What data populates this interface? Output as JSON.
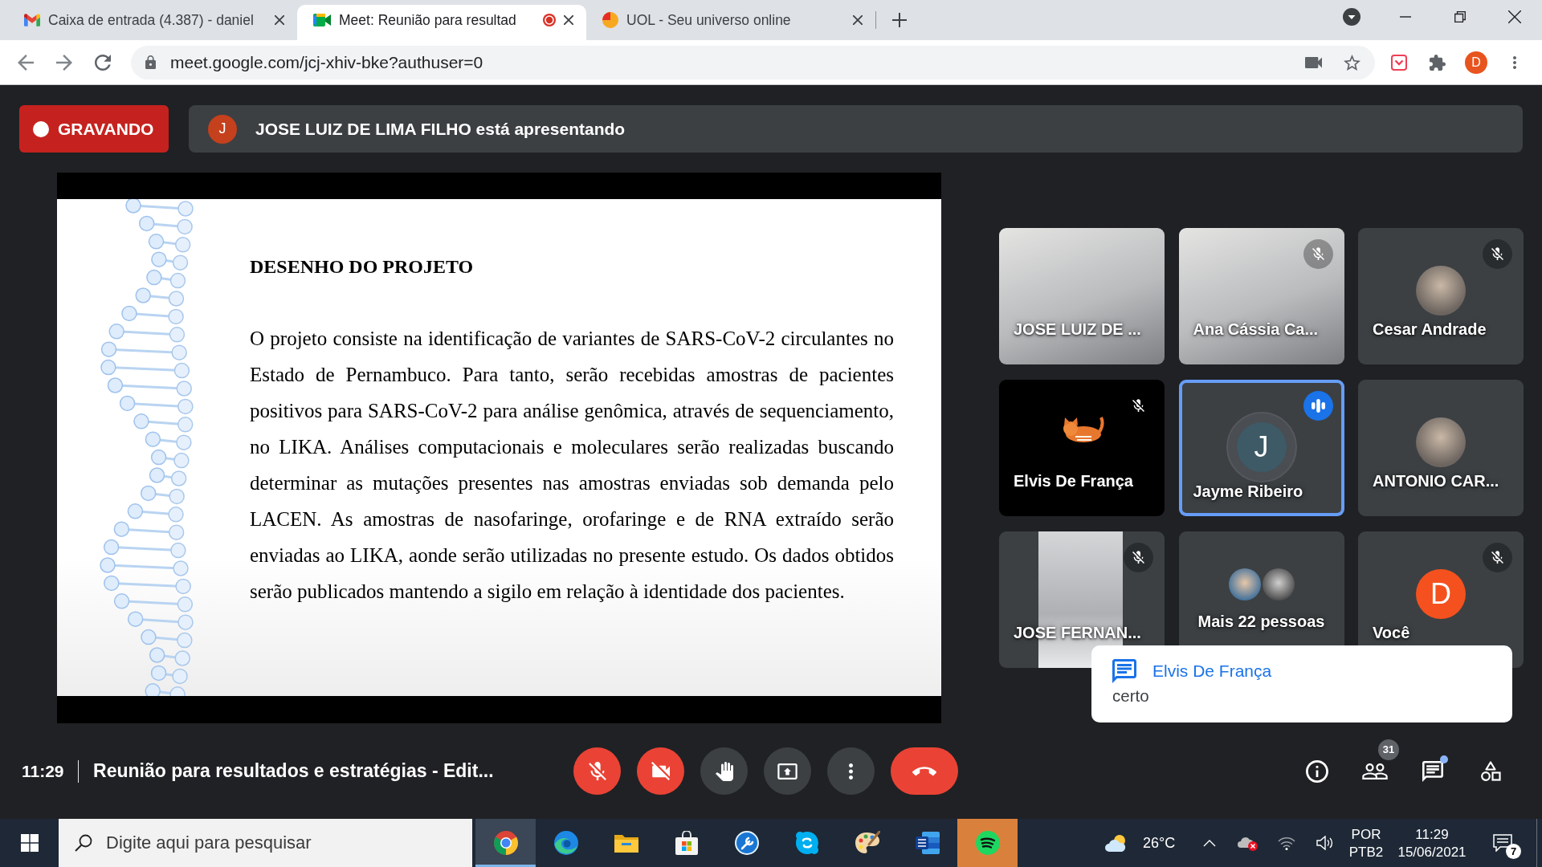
{
  "browser": {
    "tabs": [
      {
        "title": "Caixa de entrada (4.387) - daniel",
        "kind": "gmail",
        "selected": false,
        "recording": false
      },
      {
        "title": "Meet: Reunião para resultad",
        "kind": "meet",
        "selected": true,
        "recording": true
      },
      {
        "title": "UOL - Seu universo online",
        "kind": "uol",
        "selected": false,
        "recording": false
      }
    ],
    "url": "meet.google.com/jcj-xhiv-bke?authuser=0",
    "profile_initial": "D"
  },
  "meeting": {
    "recording": {
      "label": "GRAVANDO"
    },
    "presenter": {
      "initial": "J",
      "text": "JOSE LUIZ DE LIMA FILHO está apresentando"
    },
    "slide": {
      "title": "DESENHO DO PROJETO",
      "body": "O projeto consiste na identificação de variantes de SARS-CoV-2 circulantes no Estado de Pernambuco. Para tanto, serão recebidas amostras de pacientes positivos para SARS-CoV-2 para análise genômica, através de sequenciamento, no LIKA. Análises computacionais e moleculares serão realizadas buscando determinar as mutações presentes nas amostras enviadas sob demanda pelo LACEN. As amostras de nasofaringe, orofaringe e de RNA extraído serão enviadas ao LIKA, aonde serão utilizadas no presente estudo. Os dados obtidos serão publicados mantendo a sigilo em relação à identidade dos pacientes."
    },
    "tiles": [
      {
        "kind": "video",
        "name": "JOSE LUIZ DE ...",
        "muted": false,
        "speaking": false
      },
      {
        "kind": "video",
        "name": "Ana Cássia Ca...",
        "muted": true,
        "speaking": false
      },
      {
        "kind": "photo_avatar",
        "name": "Cesar Andrade",
        "muted": true,
        "speaking": false
      },
      {
        "kind": "camera_message",
        "name": "Elvis De França",
        "muted": true,
        "speaking": false
      },
      {
        "kind": "letter_avatar",
        "name": "Jayme Ribeiro",
        "initial": "J",
        "color": "#3d5a66",
        "muted": false,
        "speaking": true
      },
      {
        "kind": "photo_avatar",
        "name": "ANTONIO CAR...",
        "muted": false,
        "speaking": false
      },
      {
        "kind": "narrow_video",
        "name": "JOSE FERNAN...",
        "muted": true,
        "speaking": false
      },
      {
        "kind": "group",
        "name": "Mais 22 pessoas",
        "muted": false,
        "speaking": false
      },
      {
        "kind": "letter_avatar",
        "name": "Você",
        "initial": "D",
        "color": "#f4511e",
        "muted": true,
        "speaking": false
      }
    ],
    "chat_popup": {
      "sender": "Elvis De França",
      "message": "certo"
    },
    "time": "11:29",
    "title": "Reunião para resultados e estratégias - Edit...",
    "controls": [
      {
        "kind": "mic",
        "on": false
      },
      {
        "kind": "camera",
        "on": false
      },
      {
        "kind": "hand"
      },
      {
        "kind": "present"
      },
      {
        "kind": "more"
      },
      {
        "kind": "leave"
      }
    ],
    "side_controls": [
      {
        "kind": "info"
      },
      {
        "kind": "people",
        "badge": "31"
      },
      {
        "kind": "chat",
        "unread": true
      },
      {
        "kind": "activities"
      }
    ]
  },
  "taskbar": {
    "search": {
      "placeholder": "Digite aqui para pesquisar"
    },
    "apps": [
      {
        "kind": "chrome",
        "active": true,
        "flashing": false
      },
      {
        "kind": "edge",
        "active": false,
        "flashing": false
      },
      {
        "kind": "explorer",
        "active": false,
        "flashing": false
      },
      {
        "kind": "store",
        "active": false,
        "flashing": false
      },
      {
        "kind": "tool",
        "active": false,
        "flashing": false
      },
      {
        "kind": "skype",
        "active": false,
        "flashing": false
      },
      {
        "kind": "paint",
        "active": false,
        "flashing": false
      },
      {
        "kind": "word",
        "active": false,
        "flashing": false
      },
      {
        "kind": "spotify",
        "active": false,
        "flashing": true
      }
    ],
    "temperature": "26°C",
    "language": "POR",
    "layout": "PTB2",
    "time": "11:29",
    "date": "15/06/2021",
    "notifications": "7"
  }
}
